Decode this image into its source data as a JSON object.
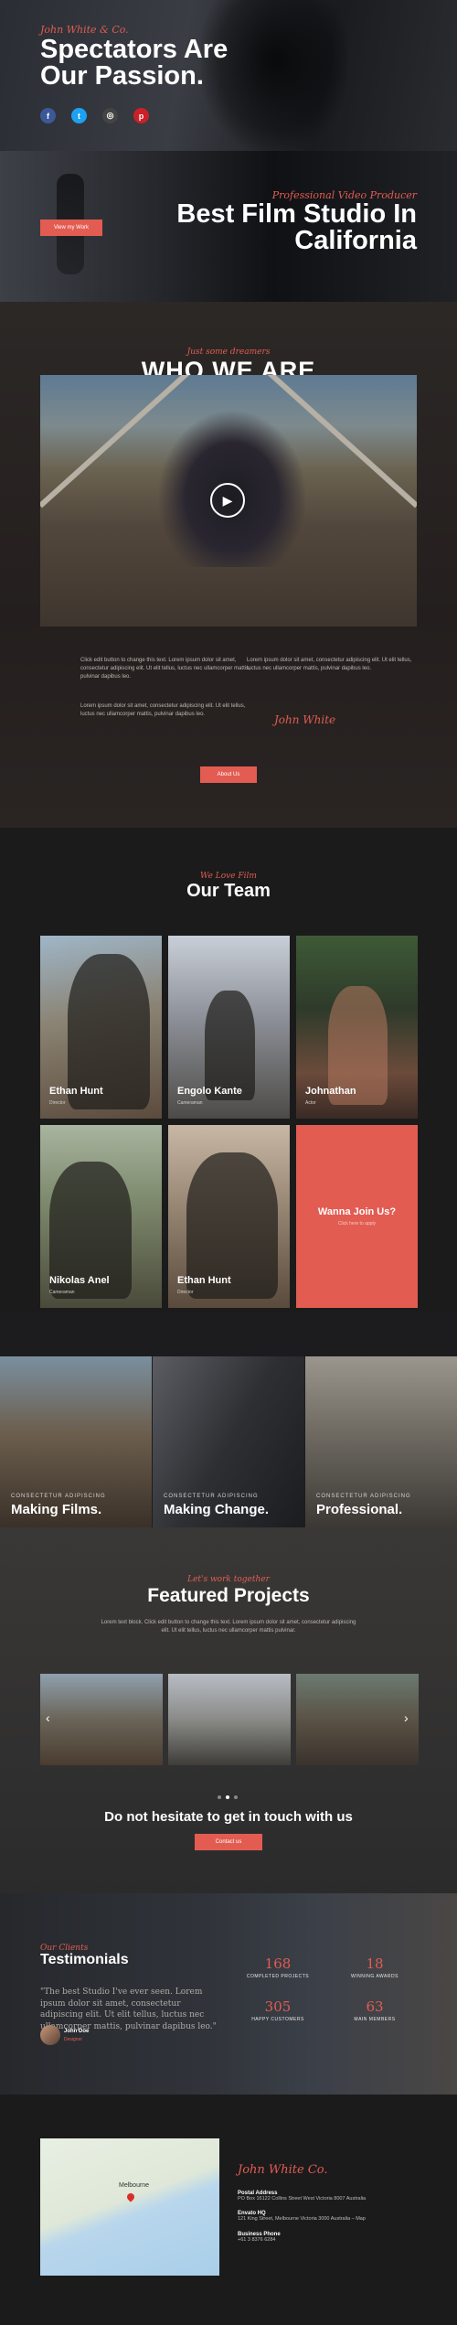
{
  "hero": {
    "script": "John White & Co.",
    "title": "Spectators Are Our Passion.",
    "socials": [
      {
        "icon": "facebook-icon",
        "glyph": "f",
        "color": "#3b5998"
      },
      {
        "icon": "twitter-icon",
        "glyph": "t",
        "color": "#1da1f2"
      },
      {
        "icon": "instagram-icon",
        "glyph": "◎",
        "color": "#444444"
      },
      {
        "icon": "pinterest-icon",
        "glyph": "p",
        "color": "#cb2027"
      }
    ]
  },
  "studio": {
    "button": "View my Work",
    "script": "Professional Video Producer",
    "title": "Best Film Studio In California"
  },
  "who": {
    "script": "Just some dreamers",
    "title": "WHO WE ARE",
    "para1": "Click edit button to change this text. Lorem ipsum dolor sit amet, consectetur adipiscing elit. Ut elit tellus, luctus nec ullamcorper mattis, pulvinar dapibus leo.",
    "para2": "Lorem ipsum dolor sit amet, consectetur adipiscing elit. Ut elit tellus, luctus nec ullamcorper mattis, pulvinar dapibus leo.",
    "para3": "Lorem ipsum dolor sit amet, consectetur adipiscing elit. Ut elit tellus, luctus nec ullamcorper mattis, pulvinar dapibus leo.",
    "signature": "John White",
    "button": "About Us"
  },
  "team": {
    "script": "We Love Film",
    "title": "Our Team",
    "members": [
      {
        "name": "Ethan Hunt",
        "role": "Director"
      },
      {
        "name": "Engolo Kante",
        "role": "Cameraman"
      },
      {
        "name": "Johnathan",
        "role": "Actor"
      },
      {
        "name": "Nikolas Anel",
        "role": "Cameraman"
      },
      {
        "name": "Ethan Hunt",
        "role": "Director"
      }
    ],
    "join_title": "Wanna Join Us?",
    "join_sub": "Click here to apply"
  },
  "banners": [
    {
      "kicker": "CONSECTETUR ADIPISCING",
      "heading": "Making Films."
    },
    {
      "kicker": "CONSECTETUR ADIPISCING",
      "heading": "Making Change."
    },
    {
      "kicker": "CONSECTETUR ADIPISCING",
      "heading": "Professional."
    }
  ],
  "featured": {
    "script": "Let's work together",
    "title": "Featured Projects",
    "lead": "Lorem text block. Click edit button to change this text. Lorem ipsum dolor sit amet, consectetur adipiscing elit. Ut elit tellus, luctus nec ullamcorper mattis pulvinar.",
    "prev": "‹",
    "next": "›",
    "cta": "Do not hesitate to get in touch with us",
    "button": "Contact us"
  },
  "testimonials": {
    "script": "Our Clients",
    "title": "Testimonials",
    "quote": "\"The best Studio I've ever seen. Lorem ipsum dolor sit amet, consectetur adipiscing elit. Ut elit tellus, luctus nec ullamcorper mattis, pulvinar dapibus leo.\"",
    "author": "John Doe",
    "author_role": "Designer",
    "stats": [
      {
        "number": "168",
        "label": "COMPLETED PROJECTS"
      },
      {
        "number": "18",
        "label": "WINNING AWARDS"
      },
      {
        "number": "305",
        "label": "HAPPY CUSTOMERS"
      },
      {
        "number": "63",
        "label": "MAIN MEMBERS"
      }
    ]
  },
  "contact": {
    "map_label": "Melbourne",
    "signature": "John White Co.",
    "postal_label": "Postal Address",
    "postal": "PO Box 16122 Collins Street West Victoria 8007 Australia",
    "envato_label": "Envato HQ",
    "envato": "121 King Street, Melbourne Victoria 3000 Australia – Map",
    "phone_label": "Business Phone",
    "phone": "+61 3 8376 6284"
  },
  "colors": {
    "accent": "#e25c52",
    "dark": "#1c1c1e"
  }
}
